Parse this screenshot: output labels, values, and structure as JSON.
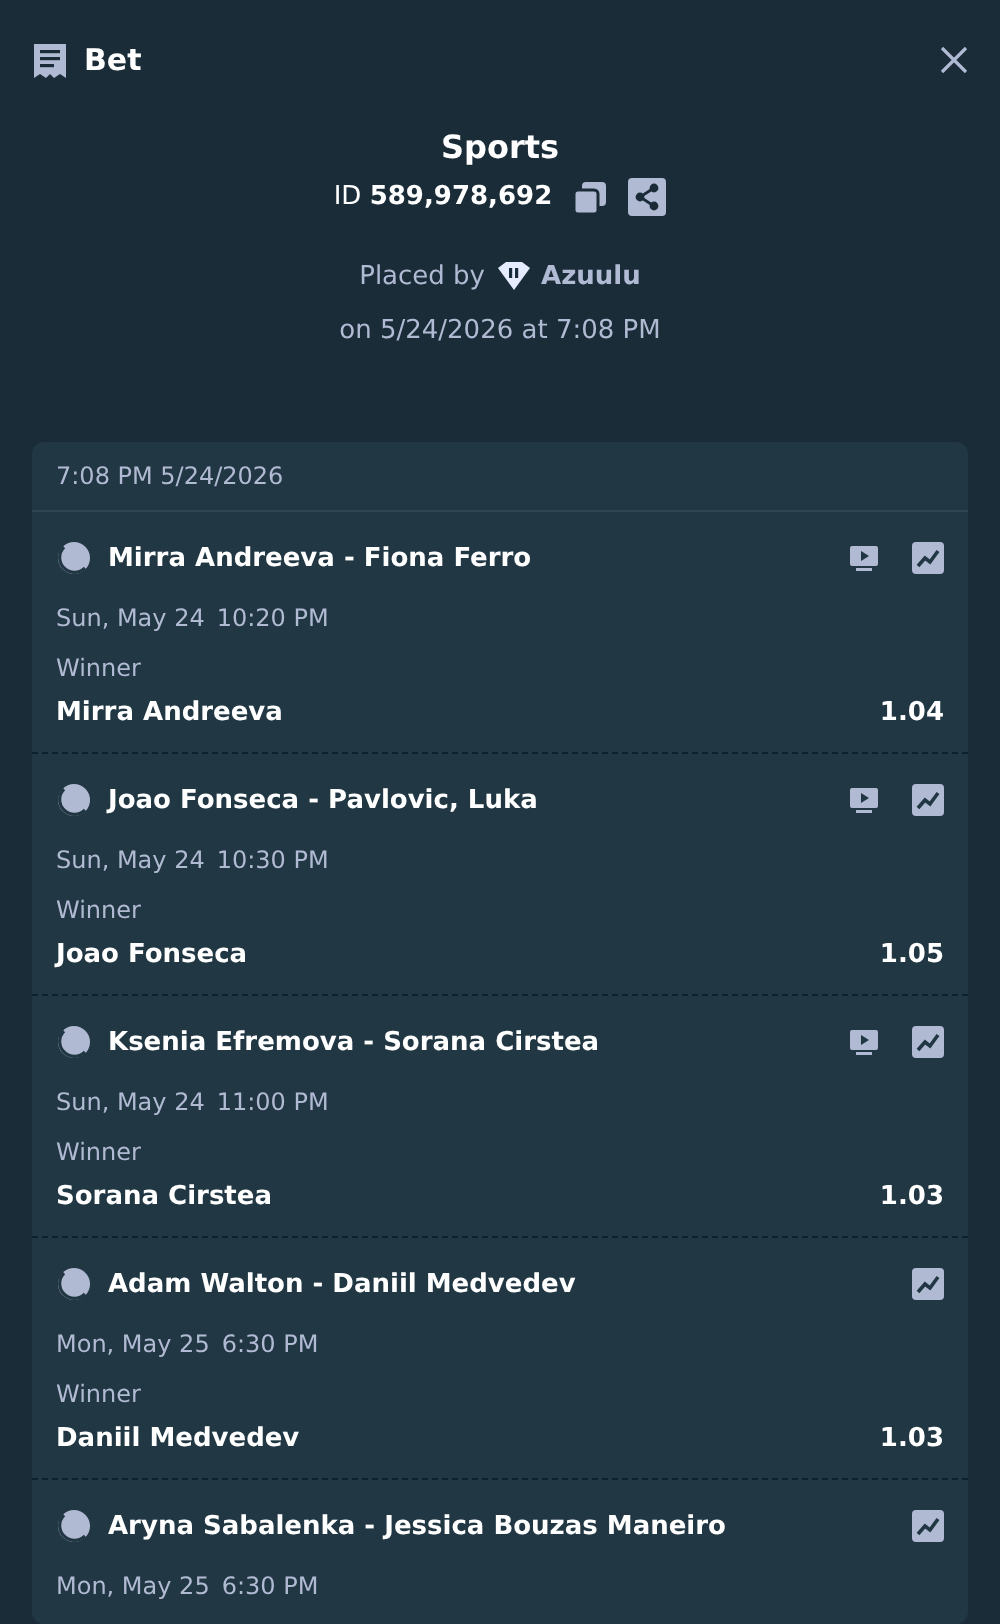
{
  "header": {
    "title": "Bet"
  },
  "summary": {
    "title": "Sports",
    "id_label": "ID",
    "id_value": "589,978,692",
    "placed_by": "Placed by",
    "user": "Azuulu",
    "placed_on": "on 5/24/2026 at 7:08 PM"
  },
  "card": {
    "timestamp": "7:08 PM 5/24/2026",
    "legs": [
      {
        "match": "Mirra Andreeva - Fiona Ferro",
        "date": "Sun, May 24",
        "time": "10:20 PM",
        "stream": true,
        "market": "Winner",
        "pick": "Mirra Andreeva",
        "odds": "1.04"
      },
      {
        "match": "Joao Fonseca - Pavlovic, Luka",
        "date": "Sun, May 24",
        "time": "10:30 PM",
        "stream": true,
        "market": "Winner",
        "pick": "Joao Fonseca",
        "odds": "1.05"
      },
      {
        "match": "Ksenia Efremova - Sorana Cirstea",
        "date": "Sun, May 24",
        "time": "11:00 PM",
        "stream": true,
        "market": "Winner",
        "pick": "Sorana Cirstea",
        "odds": "1.03"
      },
      {
        "match": "Adam Walton - Daniil Medvedev",
        "date": "Mon, May 25",
        "time": "6:30 PM",
        "stream": false,
        "market": "Winner",
        "pick": "Daniil Medvedev",
        "odds": "1.03"
      },
      {
        "match": "Aryna Sabalenka - Jessica Bouzas Maneiro",
        "date": "Mon, May 25",
        "time": "6:30 PM",
        "stream": false
      }
    ]
  }
}
